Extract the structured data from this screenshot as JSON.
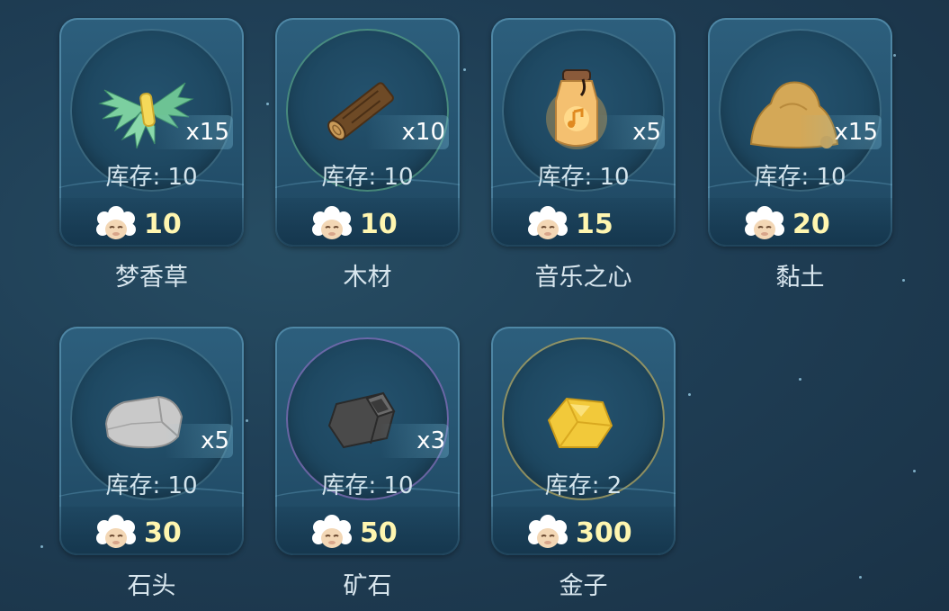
{
  "shop": {
    "stock_prefix": "库存:",
    "items": [
      {
        "name": "梦香草",
        "quantity": "x15",
        "stock": "10",
        "price": "10",
        "icon": "herb-bundle-icon"
      },
      {
        "name": "木材",
        "quantity": "x10",
        "stock": "10",
        "price": "10",
        "icon": "wood-log-icon"
      },
      {
        "name": "音乐之心",
        "quantity": "x5",
        "stock": "10",
        "price": "15",
        "icon": "music-heart-jar-icon"
      },
      {
        "name": "黏土",
        "quantity": "x15",
        "stock": "10",
        "price": "20",
        "icon": "clay-pile-icon"
      },
      {
        "name": "石头",
        "quantity": "x5",
        "stock": "10",
        "price": "30",
        "icon": "stone-icon"
      },
      {
        "name": "矿石",
        "quantity": "x3",
        "stock": "10",
        "price": "50",
        "icon": "ore-icon"
      },
      {
        "name": "金子",
        "quantity": "",
        "stock": "2",
        "price": "300",
        "icon": "gold-nugget-icon"
      }
    ],
    "currency_icon": "sheep-currency-icon"
  },
  "colors": {
    "background": "#1f3e55",
    "card": "#2a5a78",
    "price_text": "#fff6b0",
    "label_text": "#d8e6ee"
  }
}
